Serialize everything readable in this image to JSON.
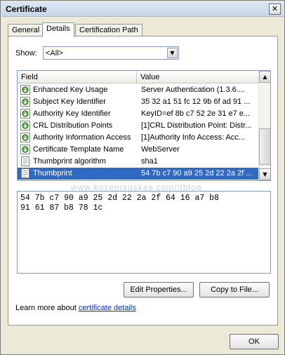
{
  "window": {
    "title": "Certificate",
    "close_glyph": "✕"
  },
  "tabs": [
    {
      "label": "General",
      "active": false
    },
    {
      "label": "Details",
      "active": true
    },
    {
      "label": "Certification Path",
      "active": false
    }
  ],
  "show": {
    "label": "Show:",
    "value": "<All>"
  },
  "listview": {
    "headers": {
      "field": "Field",
      "value": "Value"
    },
    "rows": [
      {
        "field": "Enhanced Key Usage",
        "value": "Server Authentication (1.3.6....",
        "icon": "extension-icon",
        "selected": false
      },
      {
        "field": "Subject Key Identifier",
        "value": "35 32 a1 51 fc 12 9b 6f ad 91 ...",
        "icon": "extension-icon",
        "selected": false
      },
      {
        "field": "Authority Key Identifier",
        "value": "KeyID=ef 8b c7 52 2e 31 e7 e...",
        "icon": "extension-icon",
        "selected": false
      },
      {
        "field": "CRL Distribution Points",
        "value": "[1]CRL Distribution Point: Distr...",
        "icon": "extension-icon",
        "selected": false
      },
      {
        "field": "Authority Information Access",
        "value": "[1]Authority Info Access: Acc...",
        "icon": "extension-icon",
        "selected": false
      },
      {
        "field": "Certificate Template Name",
        "value": "WebServer",
        "icon": "extension-icon",
        "selected": false
      },
      {
        "field": "Thumbprint algorithm",
        "value": "sha1",
        "icon": "document-icon",
        "selected": false
      },
      {
        "field": "Thumbprint",
        "value": "54 7b c7 90 a9 25 2d 22 2a 2f ...",
        "icon": "document-icon",
        "selected": true
      }
    ]
  },
  "scrollbar": {
    "up_glyph": "▲",
    "down_glyph": "▼"
  },
  "value_detail": "54 7b c7 90 a9 25 2d 22 2a 2f 64 16 a7 b8\n91 61 87 b8 78 1c",
  "watermark": "www.kozeniauskas.com/itblog",
  "buttons": {
    "edit_properties": "Edit Properties...",
    "copy_to_file": "Copy to File..."
  },
  "learn_more": {
    "prefix": "Learn more about ",
    "link": "certificate details"
  },
  "ok_label": "OK"
}
